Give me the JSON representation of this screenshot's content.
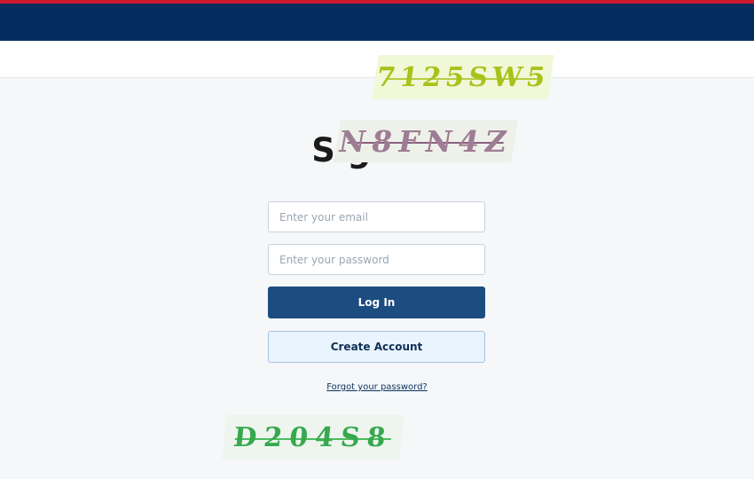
{
  "colors": {
    "top_accent": "#d0182f",
    "navbar": "#032d5f",
    "primary_button": "#1c4c80",
    "secondary_button_bg": "#eaf4ff",
    "link": "#0e3560"
  },
  "page": {
    "title": "Sign in"
  },
  "form": {
    "email_placeholder": "Enter your email",
    "password_placeholder": "Enter your password",
    "login_label": "Log In",
    "create_account_label": "Create Account",
    "forgot_password_label": "Forgot your password?"
  },
  "captchas": [
    {
      "text": "7125SW5"
    },
    {
      "text": "N8FN4Z"
    },
    {
      "text": "D204S8"
    }
  ]
}
